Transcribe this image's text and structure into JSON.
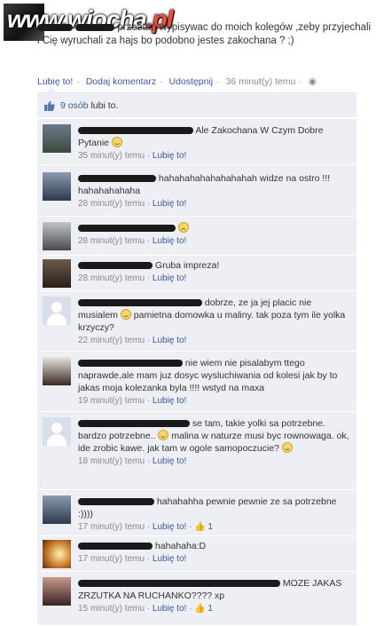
{
  "post": {
    "text_part1": "przestań wypisywac do moich kolegów ,zeby przyjechali i Cię wyruchali za hajs bo podobno jestes zakochana ? ;)",
    "actions": {
      "like": "Lubię to!",
      "comment": "Dodaj komentarz",
      "share": "Udostępnij",
      "time": "36 minut(y) temu"
    }
  },
  "watermark": {
    "name": "www.wiocha",
    "tld": ".pl"
  },
  "likes": {
    "text": "9 osób",
    "suffix": "lubi to."
  },
  "comments": [
    {
      "text_a": "Ale Zakochana W Czym Dobre",
      "text_b": "Pytanie",
      "time": "35 minut(y) temu",
      "like": "Lubię to!"
    },
    {
      "text_a": "hahahahahahahahahah widze na ostro !!! hahahahahaha",
      "time": "28 minut(y) temu",
      "like": "Lubię to!"
    },
    {
      "time": "28 minut(y) temu",
      "like": "Lubię to!"
    },
    {
      "text_a": "Gruba impreza!",
      "time": "28 minut(y) temu",
      "like": "Lubię to!"
    },
    {
      "text_a": "dobrze, ze ja jej placic nie",
      "text_b": "musialem",
      "text_c": "pamietna domowka u maliny. tak poza tym ile yolka krzyczy?",
      "time": "22 minut(y) temu",
      "like": "Lubię to!"
    },
    {
      "text_a": "nie wiem nie pisalabym ttego naprawde,ale mam juz dosyc wysluchiwania od kolesi jak by to jakas moja kolezanka byla !!!! wstyd na maxa",
      "time": "19 minut(y) temu",
      "like": "Lubię to!"
    },
    {
      "text_a": "se tam, takie yolki sa potrzebne. bardzo potrzebne..",
      "text_b": "malina w naturze musi byc rownowaga. ok, ide zrobic kawe. jak tam w ogole samopoczucie?",
      "time": "18 minut(y) temu",
      "like": "Lubię to!"
    },
    {
      "text_a": "hahahahha pewnie pewnie ze sa potrzebne :))))",
      "time": "17 minut(y) temu",
      "like": "Lubię to!",
      "count": "1"
    },
    {
      "text_a": "hahahaha:D",
      "time": "17 minut(y) temu",
      "like": "Lubię to!"
    },
    {
      "text_a": "MOZE JAKAS ZRZUTKA NA RUCHANKO???? xp",
      "time": "15 minut(y) temu",
      "like": "Lubię to!",
      "count": "1"
    }
  ]
}
